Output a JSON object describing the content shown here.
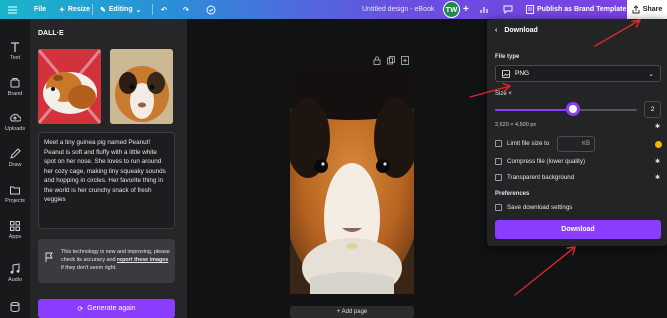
{
  "topbar": {
    "menu_icon": "hamburger-icon",
    "file_label": "File",
    "resize_label": "Resize",
    "editing_label": "Editing",
    "doc_title": "Untitled design - eBook",
    "avatar_initials": "TW",
    "publish_label": "Publish as Brand Template",
    "share_label": "Share"
  },
  "rail": {
    "items": [
      {
        "label": "Text",
        "icon": "text-icon"
      },
      {
        "label": "Brand",
        "icon": "brand-icon"
      },
      {
        "label": "Uploads",
        "icon": "upload-icon"
      },
      {
        "label": "Draw",
        "icon": "draw-icon"
      },
      {
        "label": "Projects",
        "icon": "folder-icon"
      },
      {
        "label": "Apps",
        "icon": "apps-icon"
      },
      {
        "label": "Audio",
        "icon": "audio-icon"
      }
    ]
  },
  "panel": {
    "title": "DALL·E",
    "more": "•••",
    "description": "Meet a tiny guinea pig named Peanut! Peanut is soft and fluffy with a little white spot on her nose. She loves to run around her cozy cage, making tiny squeaky sounds and hopping in circles. Her favorite thing in the world is her crunchy snack of fresh veggies",
    "note_prefix": "This technology is new and improving, please check its accuracy and ",
    "note_link": "report these images",
    "note_suffix": " if they don't seem right.",
    "regenerate_label": "Generate again"
  },
  "canvas": {
    "add_page_label": "+ Add page"
  },
  "download": {
    "title": "Download",
    "file_type_label": "File type",
    "file_type_value": "PNG",
    "size_label": "Size ×",
    "size_value": "2",
    "size_fraction": 0.55,
    "dimensions": "2,620 × 4,500 px",
    "limit_label": "Limit file size to",
    "kb_unit": "KB",
    "compress_label": "Compress file (lower quality)",
    "transparent_label": "Transparent background",
    "preferences_label": "Preferences",
    "save_settings_label": "Save download settings",
    "download_button": "Download"
  },
  "colors": {
    "accent": "#8b3dff",
    "annotation_arrow": "#e0242b",
    "pro_badge": "#f4b400"
  }
}
